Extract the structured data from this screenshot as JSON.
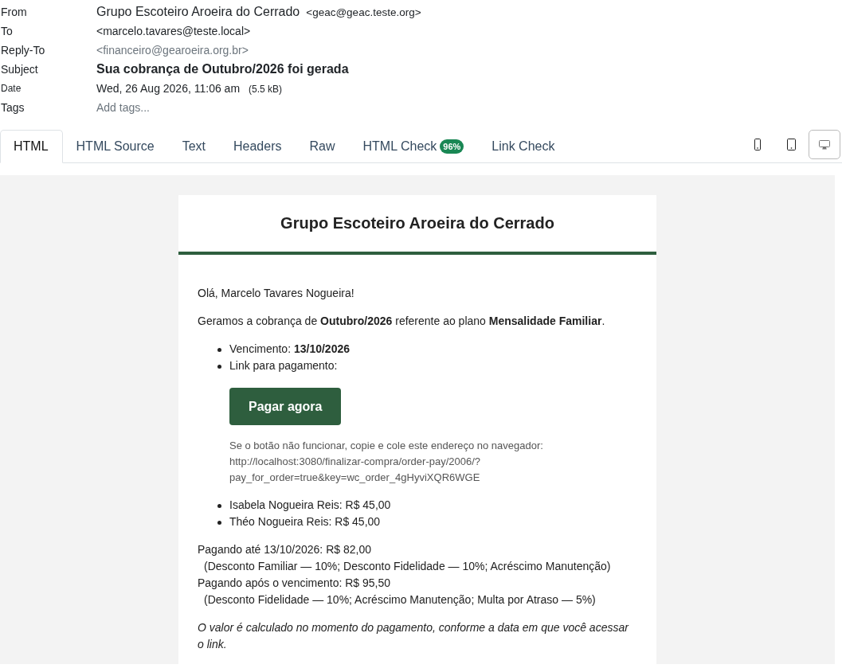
{
  "headers": [
    {
      "kind": "sender",
      "label": "From",
      "name": "Grupo Escoteiro Aroeira do Cerrado",
      "address": "<geac@geac.teste.org>"
    },
    {
      "kind": "recipient",
      "label": "To",
      "value": "<marcelo.tavares@teste.local>"
    },
    {
      "kind": "reply_to",
      "label": "Reply-To",
      "value": "<financeiro@gearoeira.org.br>"
    },
    {
      "kind": "subject",
      "label": "Subject",
      "value": "Sua cobrança de Outubro/2026 foi gerada"
    },
    {
      "kind": "date",
      "label": "Date",
      "value": "Wed, 26 Aug 2026, 11:06 am",
      "size": "(5.5 kB)"
    },
    {
      "kind": "tags",
      "label": "Tags",
      "placeholder": "Add tags..."
    }
  ],
  "tabs": [
    {
      "label": "HTML",
      "selected": true
    },
    {
      "label": "HTML Source",
      "selected": false
    },
    {
      "label": "Text",
      "selected": false
    },
    {
      "label": "Headers",
      "selected": false
    },
    {
      "label": "Raw",
      "selected": false
    },
    {
      "label": "HTML Check",
      "selected": false,
      "badge": "96%"
    },
    {
      "label": "Link Check",
      "selected": false
    }
  ],
  "view_modes": [
    {
      "kind": "phone",
      "selected": false
    },
    {
      "kind": "tablet",
      "selected": false
    },
    {
      "kind": "desktop",
      "selected": true
    }
  ],
  "email": {
    "title": "Grupo Escoteiro Aroeira do Cerrado",
    "greeting": "Olá, Marcelo Tavares Nogueira!",
    "intro": "Geramos a cobrança de **Outubro/2026** referente ao plano **Mensalidade Familiar**.",
    "details": [
      "Vencimento: **13/10/2026**",
      "Link para pagamento:"
    ],
    "pay_button": "Pagar agora",
    "fallback_note": "Se o botão não funcionar, copie e cole este endereço no navegador:",
    "fallback_url": "http://localhost:3080/finalizar-compra/order-pay/2006/?pay_for_order=true&key=wc_order_4gHyviXQR6WGE",
    "items": [
      "Isabela Nogueira Reis: R$ 45,00",
      "Théo Nogueira Reis: R$ 45,00"
    ],
    "pricing": [
      {
        "kind": "total",
        "text": "Pagando até 13/10/2026: R$ 82,00"
      },
      {
        "kind": "detail",
        "text": "(Desconto Familiar — 10%; Desconto Fidelidade — 10%; Acréscimo Manutenção)"
      },
      {
        "kind": "total",
        "text": "Pagando após o vencimento: R$ 95,50"
      },
      {
        "kind": "detail",
        "text": "(Desconto Fidelidade — 10%; Acréscimo Manutenção; Multa por Atraso — 5%)"
      }
    ],
    "footnote": "O valor é calculado no momento do pagamento, conforme a data em que você acessar o link."
  }
}
